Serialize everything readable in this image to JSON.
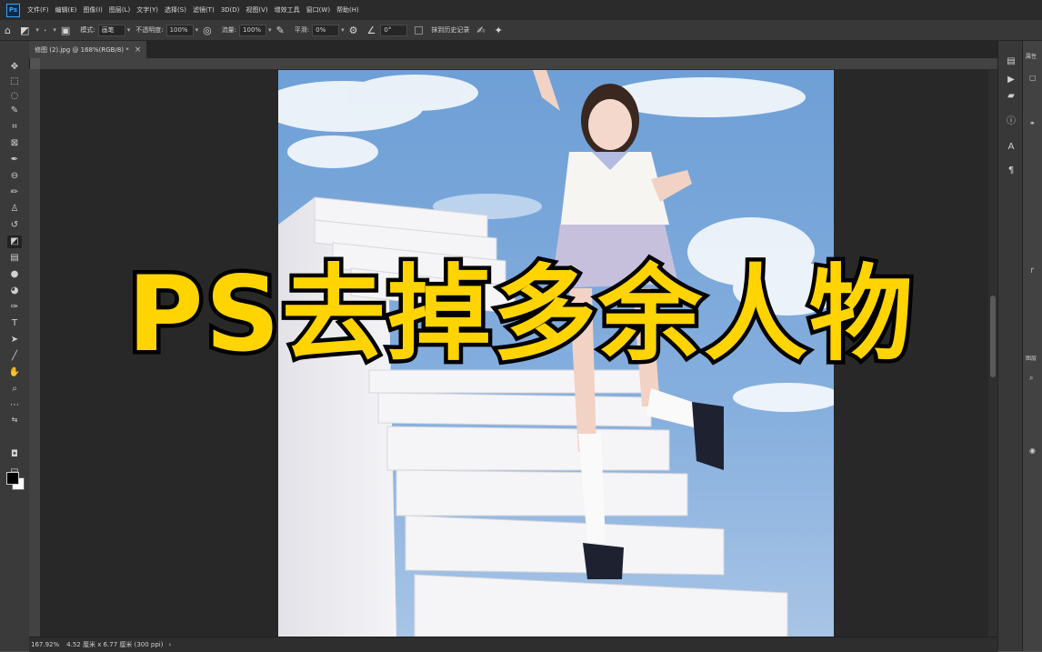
{
  "app": {
    "logo": "Ps"
  },
  "menu": [
    "文件(F)",
    "编辑(E)",
    "图像(I)",
    "图层(L)",
    "文字(Y)",
    "选择(S)",
    "滤镜(T)",
    "3D(D)",
    "视图(V)",
    "增效工具",
    "窗口(W)",
    "帮助(H)"
  ],
  "options": {
    "mode_label": "模式:",
    "mode_value": "画笔",
    "opacity_label": "不透明度:",
    "opacity_value": "100%",
    "flow_label": "流量:",
    "flow_value": "100%",
    "smooth_label": "平滑:",
    "smooth_value": "0%",
    "angle_value": "0°",
    "history_label": "抹到历史记录"
  },
  "document": {
    "tab_label": "修图 (2).jpg @ 168%(RGB/8) *",
    "close_symbol": "×"
  },
  "status": {
    "zoom": "167.92%",
    "info": "4.52 厘米 x 6.77 厘米 (300 ppi)",
    "arrow": "›"
  },
  "overlay": {
    "title": "PS去掉多余人物"
  },
  "right_panel": {
    "tab1": "属性",
    "tab2": "图层"
  },
  "colors": {
    "title_fill": "#ffd400",
    "title_stroke": "#000000",
    "sky": "#7fa8d8",
    "stairs": "#f2f2f4"
  },
  "icons": {
    "home": "home-icon",
    "eraser": "eraser-icon",
    "settings": "gear-icon"
  }
}
